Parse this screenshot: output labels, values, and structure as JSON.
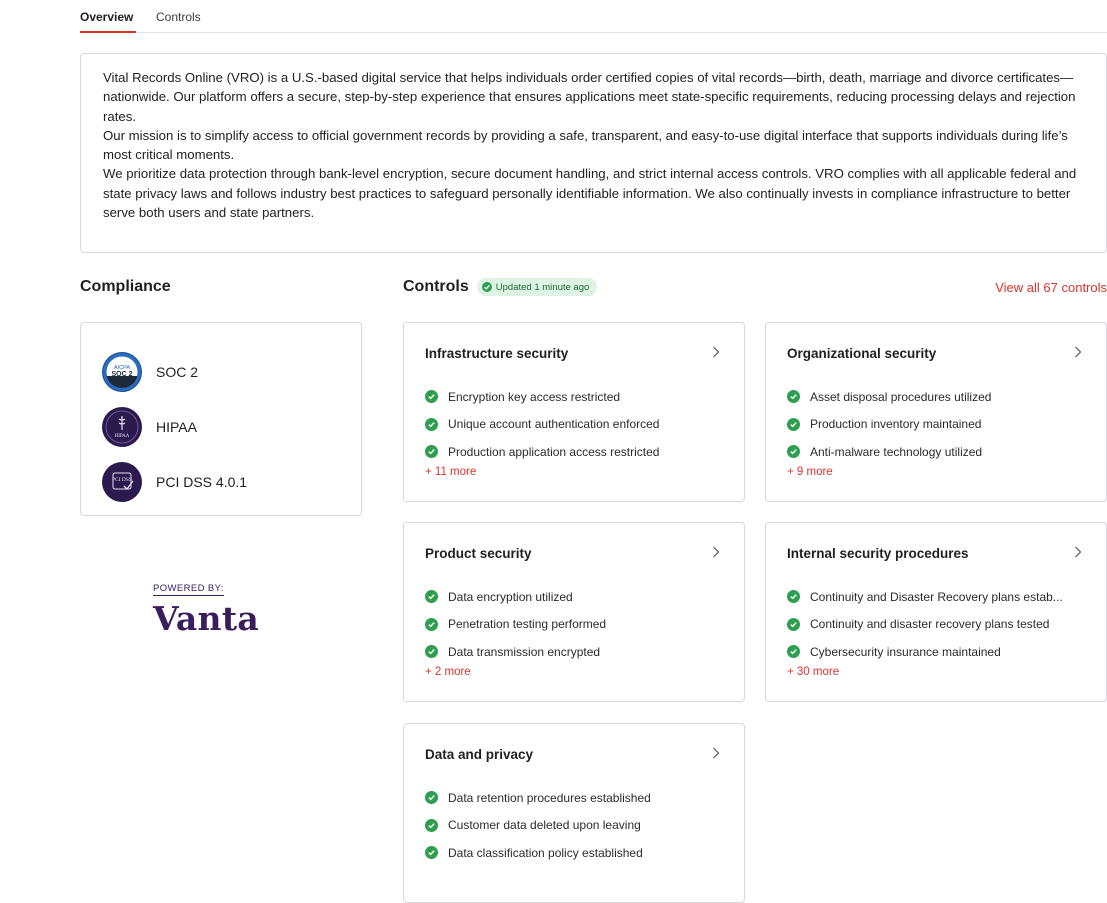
{
  "tabs": [
    {
      "label": "Overview",
      "active": true
    },
    {
      "label": "Controls",
      "active": false
    }
  ],
  "description": [
    "Vital Records Online (VRO) is a U.S.-based digital service that helps individuals order certified copies of vital records—birth, death, marriage and divorce certificates—nationwide. Our platform offers a secure, step-by-step experience that ensures applications meet state-specific requirements, reducing processing delays and rejection rates.",
    "Our mission is to simplify access to official government records by providing a safe, transparent, and easy-to-use digital interface that supports individuals during life’s most critical moments.",
    "We prioritize data protection through bank-level encryption, secure document handling, and strict internal access controls. VRO complies with all applicable federal and state privacy laws and follows industry best practices to safeguard personally identifiable information. We also continually invests in compliance infrastructure to better serve both users and state partners."
  ],
  "compliance": {
    "heading": "Compliance",
    "frameworks": [
      {
        "name": "SOC 2",
        "logo_text_top": "AICPA",
        "logo_text_bottom": "SOC 2",
        "icon": "soc2-badge-icon"
      },
      {
        "name": "HIPAA",
        "logo_text": "HIPAA",
        "icon": "hipaa-badge-icon"
      },
      {
        "name": "PCI DSS 4.0.1",
        "logo_text": "PCI DSS",
        "icon": "pci-dss-badge-icon"
      }
    ]
  },
  "vanta": {
    "powered_by": "POWERED BY:",
    "brand": "Vanta"
  },
  "controls": {
    "heading": "Controls",
    "updated_badge": "Updated 1 minute ago",
    "view_all": "View all 67 controls",
    "cards": [
      {
        "title": "Infrastructure security",
        "items": [
          "Encryption key access restricted",
          "Unique account authentication enforced",
          "Production application access restricted"
        ],
        "more": "+ 11 more"
      },
      {
        "title": "Organizational security",
        "items": [
          "Asset disposal procedures utilized",
          "Production inventory maintained",
          "Anti-malware technology utilized"
        ],
        "more": "+ 9 more"
      },
      {
        "title": "Product security",
        "items": [
          "Data encryption utilized",
          "Penetration testing performed",
          "Data transmission encrypted"
        ],
        "more": "+ 2 more"
      },
      {
        "title": "Internal security procedures",
        "items": [
          "Continuity and Disaster Recovery plans estab...",
          "Continuity and disaster recovery plans tested",
          "Cybersecurity insurance maintained"
        ],
        "more": "+ 30 more"
      },
      {
        "title": "Data and privacy",
        "items": [
          "Data retention procedures established",
          "Customer data deleted upon leaving",
          "Data classification policy established"
        ],
        "more": ""
      }
    ]
  },
  "colors": {
    "accent": "#d9342b",
    "success": "#2e9e4f",
    "brand": "#3a1d5c",
    "border": "#d9d9dd"
  }
}
